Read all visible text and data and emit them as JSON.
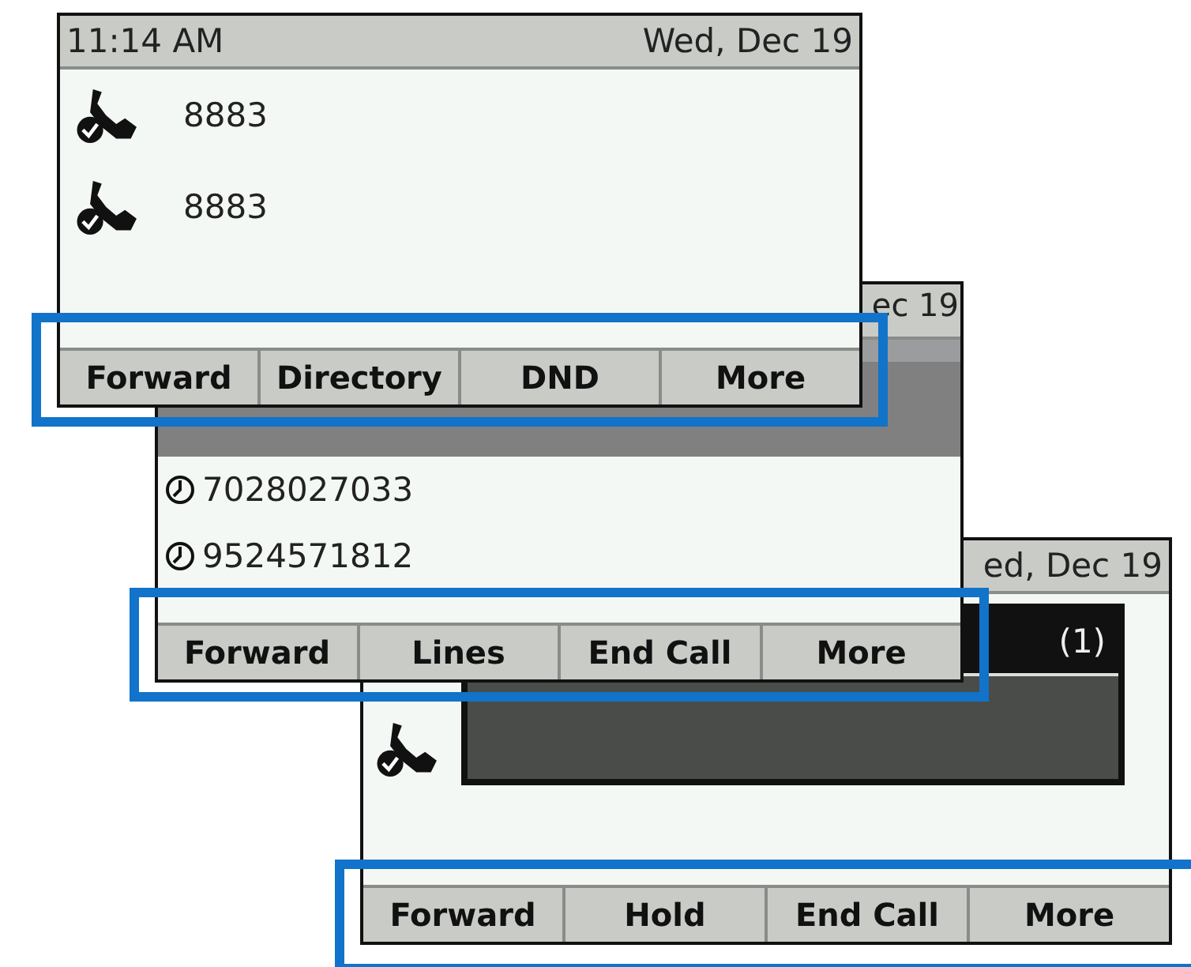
{
  "screens": [
    {
      "kind": "lines",
      "time": "11:14 AM",
      "date": "Wed, Dec 19",
      "lines": [
        {
          "number": "8883"
        },
        {
          "number": "8883"
        }
      ],
      "softkeys_highlighted": true,
      "softkeys": [
        "Forward",
        "Directory",
        "DND",
        "More"
      ]
    },
    {
      "kind": "recents",
      "date": "ec 19",
      "recent_calls": [
        {
          "number": "7028027033"
        },
        {
          "number": "9524571812"
        }
      ],
      "softkeys_highlighted": true,
      "softkeys": [
        "Forward",
        "Lines",
        "End Call",
        "More"
      ]
    },
    {
      "kind": "call",
      "date": "ed, Dec 19",
      "call_count": "(1)",
      "softkeys_highlighted": true,
      "softkeys": [
        "Forward",
        "Hold",
        "End Call",
        "More"
      ]
    }
  ]
}
